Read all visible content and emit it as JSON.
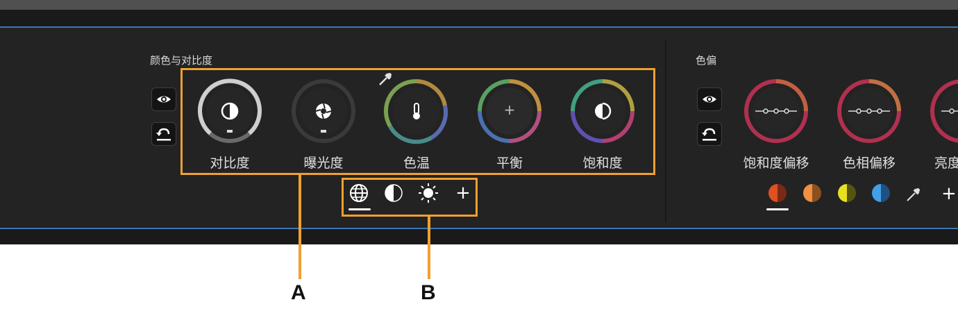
{
  "color_contrast": {
    "title": "颜色与对比度",
    "dials": [
      {
        "label": "对比度",
        "icon": "contrast-icon"
      },
      {
        "label": "曝光度",
        "icon": "aperture-icon"
      },
      {
        "label": "色温",
        "icon": "thermometer-icon"
      },
      {
        "label": "平衡",
        "icon": "plus-icon",
        "glyph": "+"
      },
      {
        "label": "饱和度",
        "icon": "saturation-icon"
      }
    ],
    "mode_tabs": [
      {
        "icon": "globe-icon",
        "selected": true
      },
      {
        "icon": "half-circle-icon",
        "selected": false
      },
      {
        "icon": "sun-icon",
        "selected": false
      },
      {
        "icon": "add-icon",
        "glyph": "+",
        "selected": false
      }
    ]
  },
  "color_cast": {
    "title": "色偏",
    "dials": [
      {
        "label": "饱和度偏移"
      },
      {
        "label": "色相偏移"
      },
      {
        "label": "亮度"
      }
    ],
    "swatches": [
      {
        "icon": "red-swatch-icon",
        "left": "#e05020",
        "right": "#7a2a14",
        "selected": true
      },
      {
        "icon": "orange-swatch-icon",
        "left": "#f09040",
        "right": "#8a5020",
        "selected": false
      },
      {
        "icon": "yellow-swatch-icon",
        "left": "#e8e020",
        "right": "#555510",
        "selected": false
      },
      {
        "icon": "blue-swatch-icon",
        "left": "#40a0e8",
        "right": "#205080",
        "selected": false
      }
    ],
    "tool_glyph": "+"
  },
  "callouts": {
    "a": "A",
    "b": "B"
  },
  "colors": {
    "accent": "#f0a030",
    "panel_border": "#3c78b4",
    "panel_bg": "#232323"
  }
}
